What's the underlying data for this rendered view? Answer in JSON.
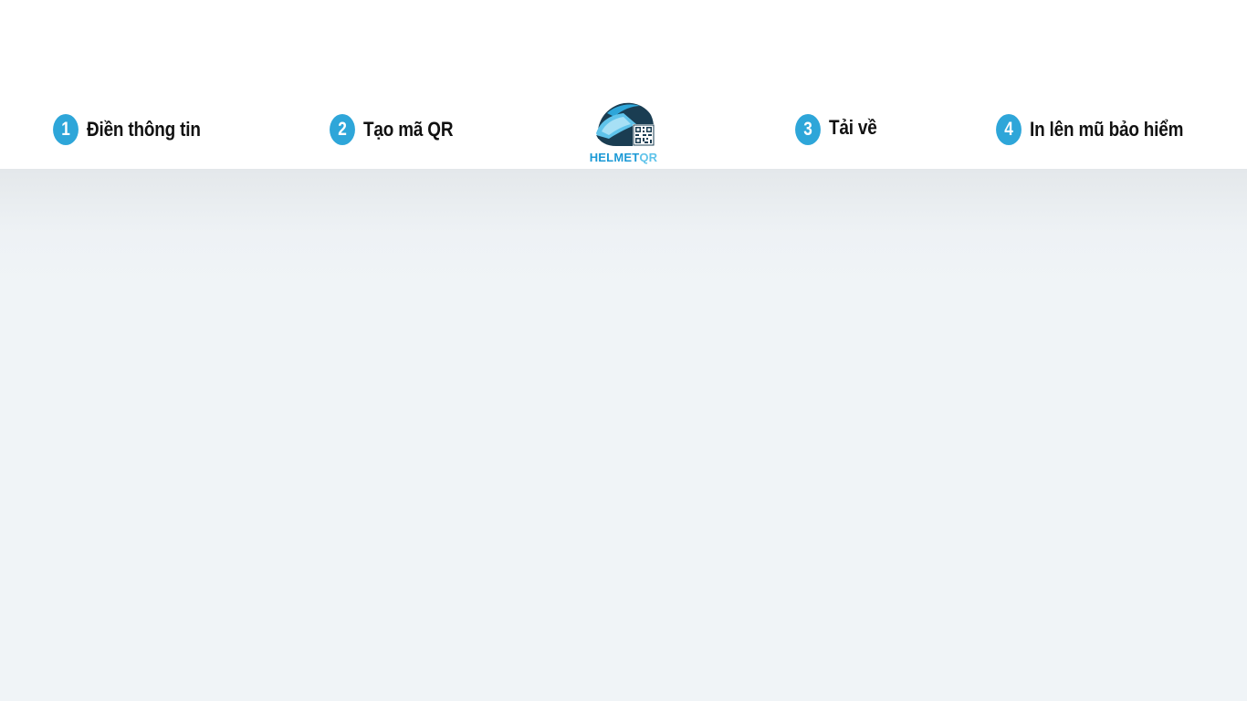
{
  "colors": {
    "accent": "#2ea6d9",
    "logo_dark": "#1a3d52",
    "logo_text_primary": "#1c9ad6",
    "logo_text_secondary": "#5fc3ea"
  },
  "steps": [
    {
      "number": "1",
      "label": "Điền thông tin"
    },
    {
      "number": "2",
      "label": "Tạo mã QR"
    },
    {
      "number": "3",
      "label": "Tải về"
    },
    {
      "number": "4",
      "label": "In lên mũ bảo hiểm"
    }
  ],
  "logo": {
    "icon": "helmet-qr-icon",
    "text_part1": "HELMET",
    "text_part2": "QR"
  }
}
